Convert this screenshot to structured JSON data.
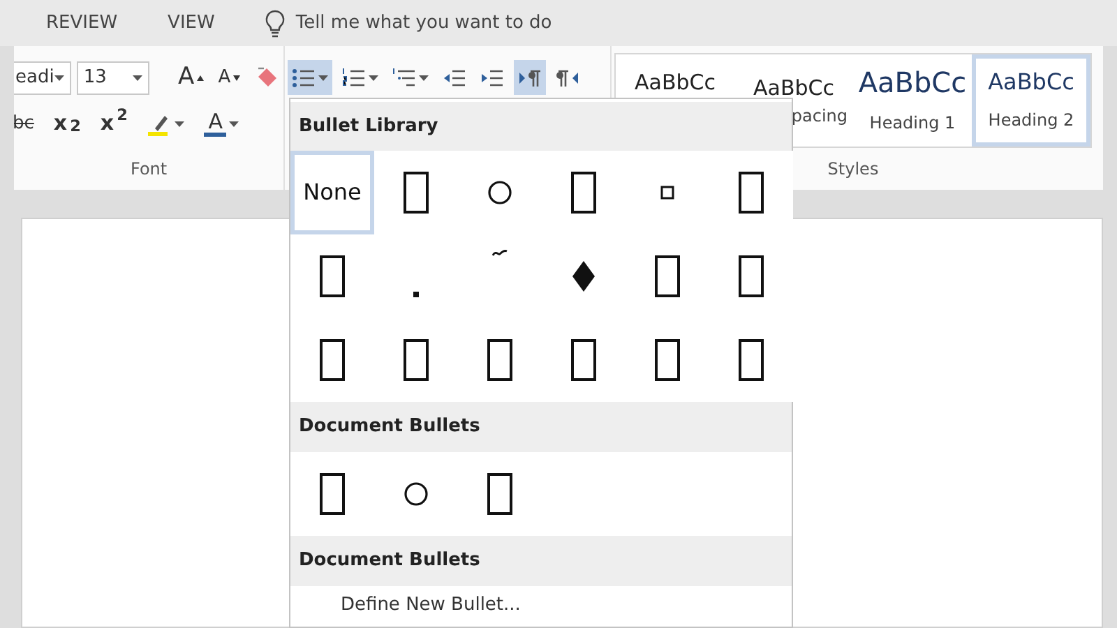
{
  "menu_tabs": [
    {
      "label": "REVIEW"
    },
    {
      "label": "VIEW"
    }
  ],
  "tell_me": {
    "placeholder": "Tell me what you want to do"
  },
  "font_group": {
    "font_name": "eadi",
    "font_size": "13",
    "label": "Font",
    "row_1": [
      {
        "kind": "grow",
        "text": "A"
      },
      {
        "kind": "shrink",
        "text": "A"
      },
      {
        "kind": "clear"
      }
    ],
    "row_2": [
      {
        "kind": "strike",
        "text": "bc"
      },
      {
        "kind": "sub",
        "text": "x$_{2}$"
      },
      {
        "kind": "sup",
        "text": "x$^{2}$"
      },
      {
        "kind": "highlight"
      },
      {
        "kind": "color",
        "text": "A"
      }
    ]
  },
  "paragraph_group": {
    "buttons": [
      {
        "kind": "bullets",
        "pressed": true,
        "dropdown": true
      },
      {
        "kind": "numbering",
        "pressed": false,
        "dropdown": true
      },
      {
        "kind": "multilevel",
        "pressed": false,
        "dropdown": true
      },
      {
        "kind": "outdent",
        "pressed": false,
        "dropdown": false
      },
      {
        "kind": "indent",
        "pressed": false,
        "dropdown": false
      },
      {
        "kind": "ltr",
        "pressed": true,
        "dropdown": false
      },
      {
        "kind": "rtl",
        "pressed": false,
        "dropdown": false
      }
    ]
  },
  "styles_group": {
    "label": "Styles",
    "items": [
      {
        "sample": "AaBbCc",
        "kind": "normal",
        "selected": false
      },
      {
        "sample": "AaBbCc",
        "name": "pacing",
        "kind": "normal",
        "selected": false
      },
      {
        "sample": "AaBbCc",
        "name": "Heading 1",
        "kind": "heading1",
        "selected": false
      },
      {
        "sample": "AaBbCc",
        "name": "Heading 2",
        "kind": "heading2",
        "selected": true
      }
    ]
  },
  "bullet_menu": {
    "sections": [
      {
        "title": "Bullet Library",
        "items": [
          {
            "kind": "none",
            "text": "None",
            "selected": true
          },
          {
            "kind": "box",
            "selected": false
          },
          {
            "kind": "circle",
            "selected": false
          },
          {
            "kind": "box",
            "selected": false
          },
          {
            "kind": "small-square",
            "selected": false
          },
          {
            "kind": "box",
            "selected": false
          },
          {
            "kind": "box",
            "selected": false
          },
          {
            "kind": "dot",
            "selected": false
          },
          {
            "kind": "tilde",
            "selected": false
          },
          {
            "kind": "diamond",
            "selected": false
          },
          {
            "kind": "box",
            "selected": false
          },
          {
            "kind": "box",
            "selected": false
          },
          {
            "kind": "box",
            "selected": false
          },
          {
            "kind": "box",
            "selected": false
          },
          {
            "kind": "box",
            "selected": false
          },
          {
            "kind": "box",
            "selected": false
          },
          {
            "kind": "box",
            "selected": false
          },
          {
            "kind": "box",
            "selected": false
          }
        ]
      },
      {
        "title": "Document Bullets",
        "items": [
          {
            "kind": "box",
            "selected": false
          },
          {
            "kind": "circle",
            "selected": false
          },
          {
            "kind": "box",
            "selected": false
          }
        ]
      },
      {
        "title": "Document Bullets"
      }
    ],
    "define": "Define New Bullet..."
  }
}
